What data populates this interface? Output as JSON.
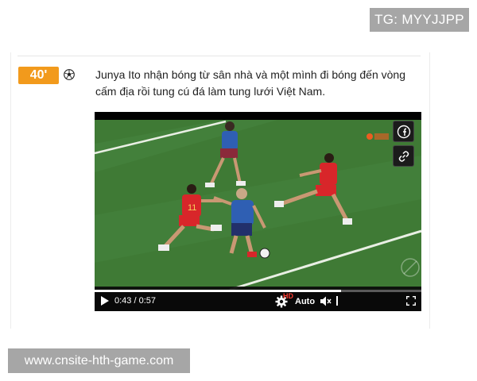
{
  "watermarks": {
    "top": "TG: MYYJJPP",
    "bottom": "www.cnsite-hth-game.com"
  },
  "event": {
    "minute": "40'",
    "icon": "soccer-ball-icon",
    "text": "Junya Ito nhận bóng từ sân nhà và một mình đi bóng đến vòng cấm địa rồi tung cú đá làm tung lưới Việt Nam."
  },
  "video": {
    "share_icons": [
      "facebook-icon",
      "link-icon"
    ],
    "current_time": "0:43",
    "duration": "0:57",
    "progress": 0.754,
    "quality_badge": "HD",
    "quality_label": "Auto",
    "colors": {
      "pitch": "#3f7a35",
      "home_kit": "#d8262a",
      "away_kit": "#2f5fb3",
      "accent": "#f29a1c"
    }
  }
}
